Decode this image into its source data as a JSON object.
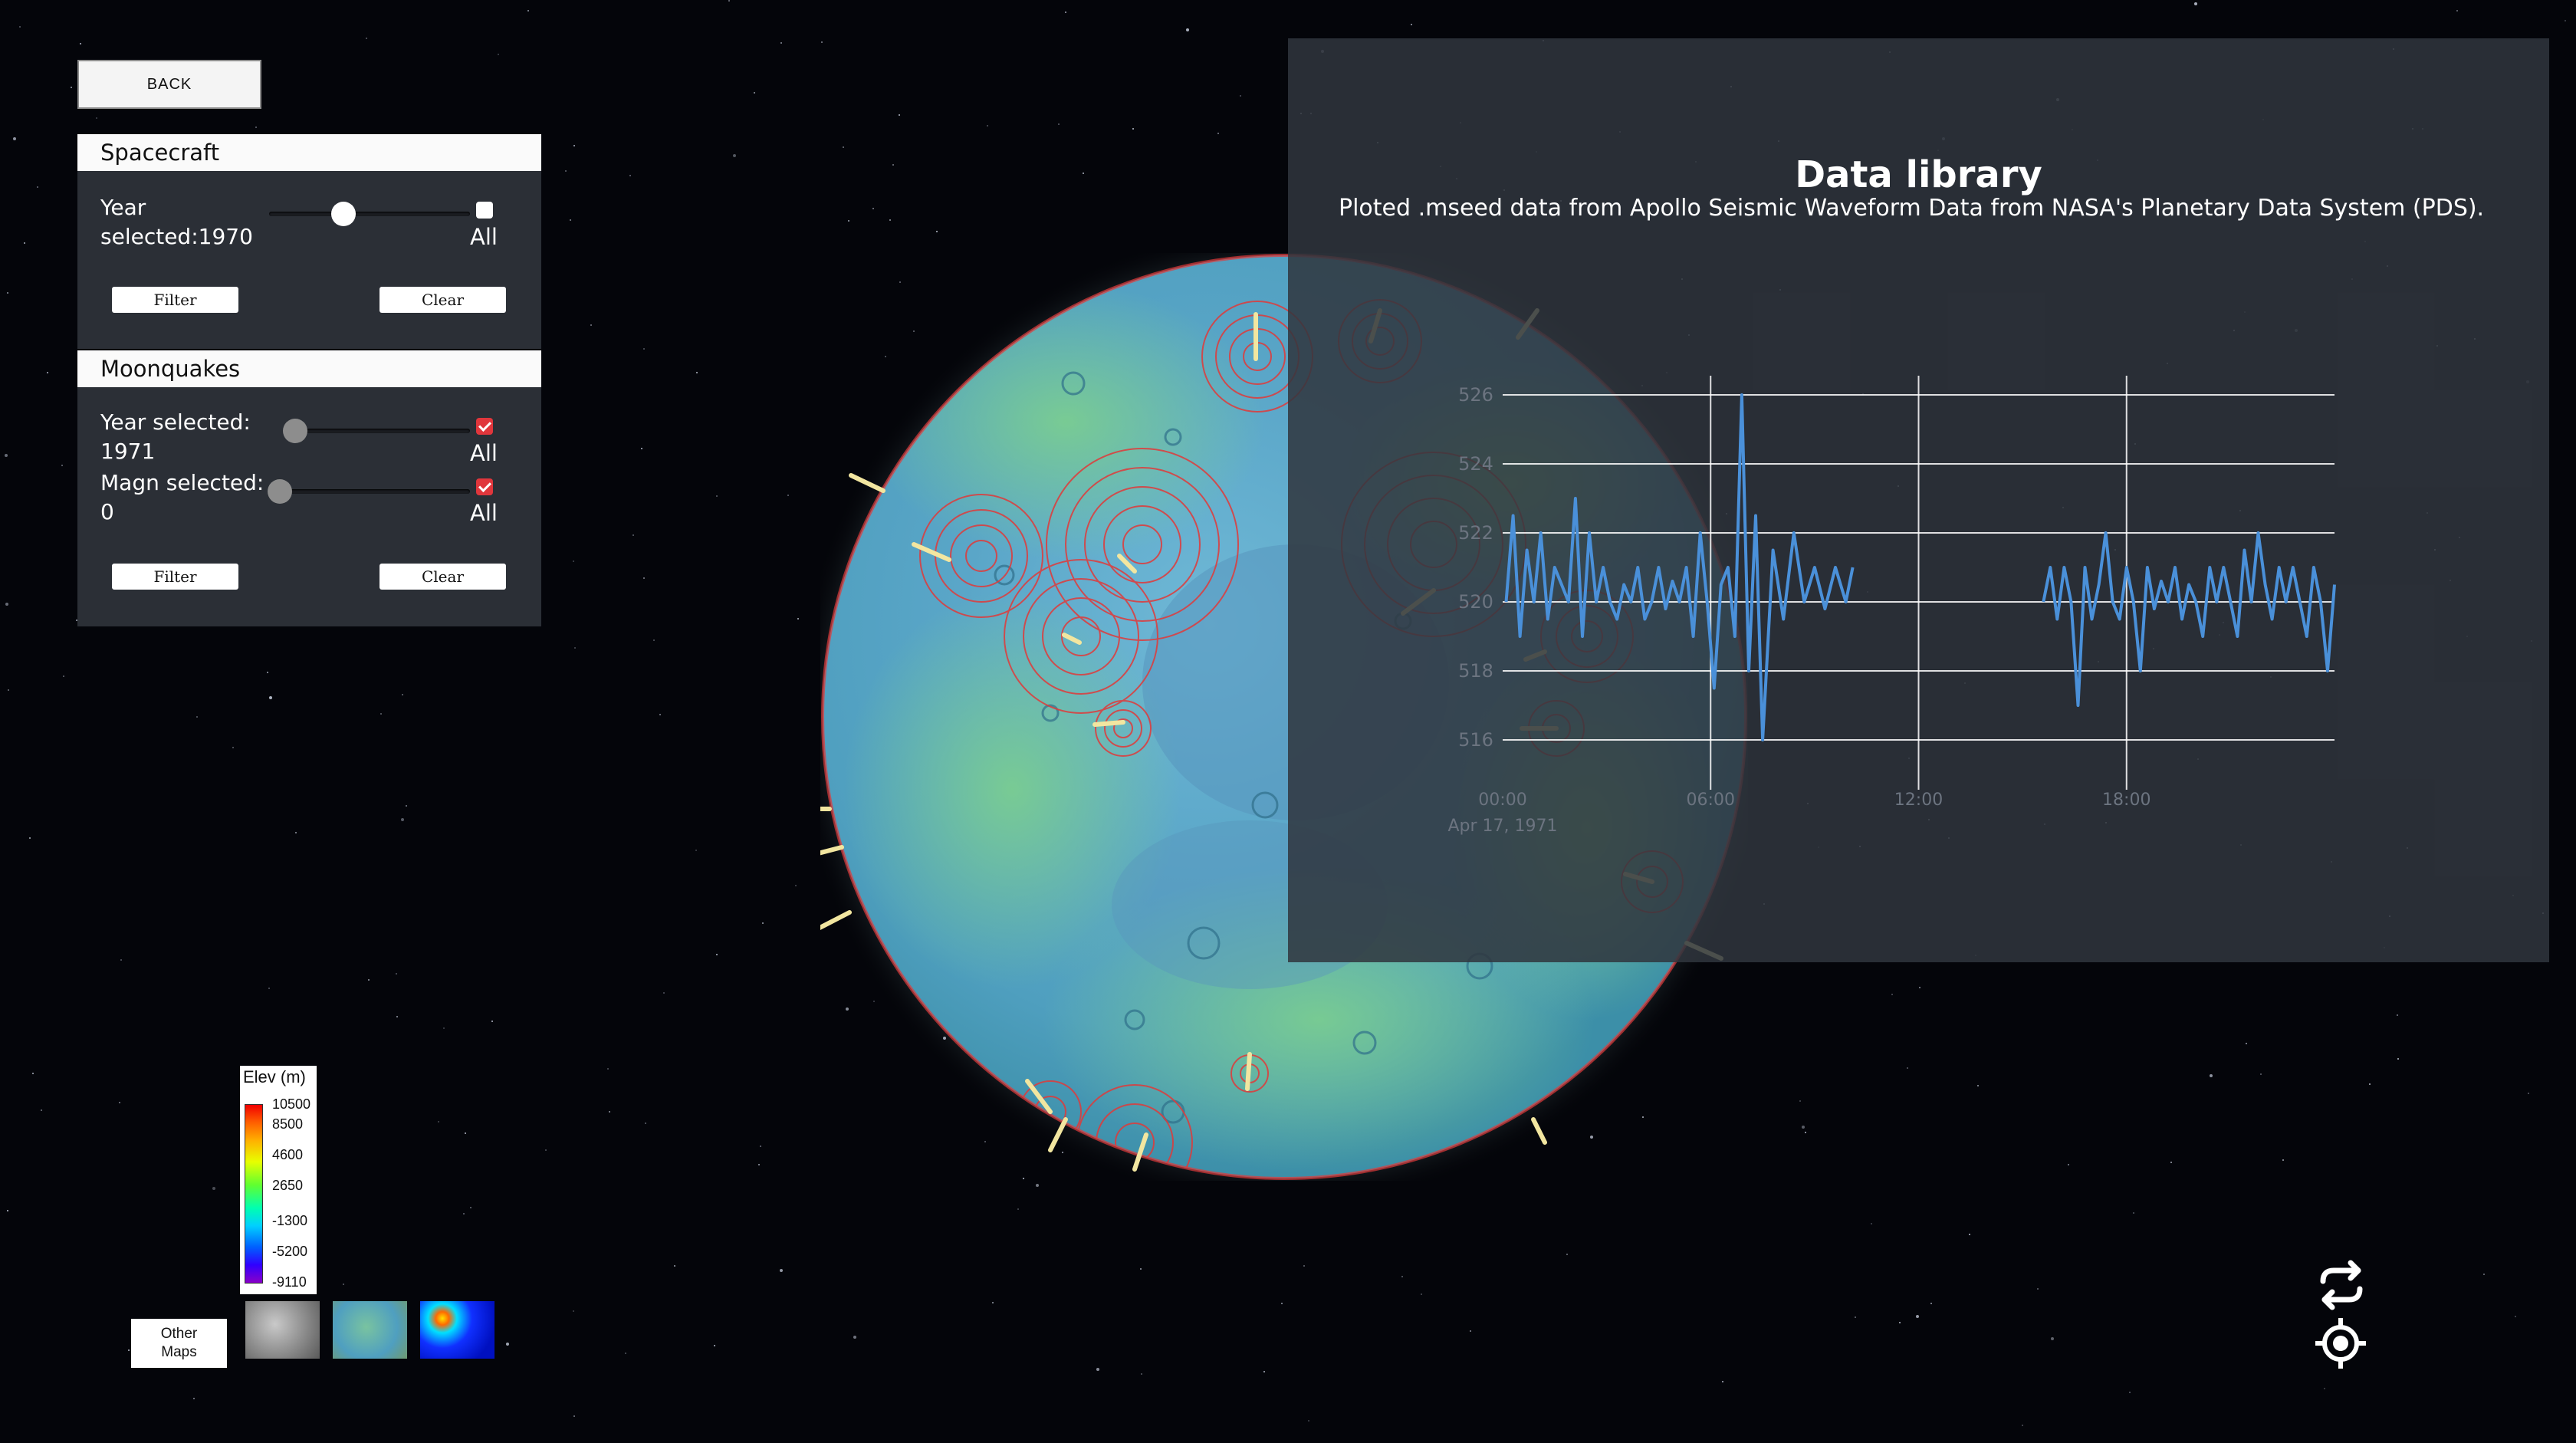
{
  "back_button": "BACK",
  "spacecraft": {
    "title": "Spacecraft",
    "year_label": "Year",
    "year_value": "selected:1970",
    "all_label": "All",
    "all_checked": false,
    "filter_label": "Filter",
    "clear_label": "Clear",
    "year_slider_fraction": 0.35
  },
  "moonquakes": {
    "title": "Moonquakes",
    "year_label": "Year selected:",
    "year_value": "1971",
    "year_all_label": "All",
    "year_all_checked": true,
    "magn_label": "Magn selected:",
    "magn_value": "0",
    "magn_all_label": "All",
    "magn_all_checked": true,
    "filter_label": "Filter",
    "clear_label": "Clear",
    "year_slider_fraction": 0.0,
    "magn_slider_fraction": 0.0
  },
  "data_library": {
    "title": "Data library",
    "subtitle": "Ploted .mseed data from Apollo Seismic Waveform Data from NASA's Planetary Data System (PDS)."
  },
  "chart_data": {
    "type": "line",
    "ylim": [
      515,
      527
    ],
    "y_ticks": [
      "526",
      "524",
      "522",
      "520",
      "518",
      "516"
    ],
    "x_ticks": [
      "00:00",
      "06:00",
      "12:00",
      "18:00"
    ],
    "x_date_label": "Apr 17, 1971",
    "series": [
      {
        "color": "#4a90d9",
        "segments": [
          {
            "hours": [
              0.1,
              0.3,
              0.5,
              0.7,
              0.9,
              1.1,
              1.3,
              1.5,
              1.7,
              1.9,
              2.1,
              2.3,
              2.5,
              2.7,
              2.9,
              3.1,
              3.3,
              3.5,
              3.7,
              3.9,
              4.1,
              4.3,
              4.5,
              4.7,
              4.9,
              5.1,
              5.3,
              5.5,
              5.7,
              5.9,
              6.1,
              6.3,
              6.5,
              6.7,
              6.9,
              7.1,
              7.3,
              7.5,
              7.8,
              8.1,
              8.4,
              8.7,
              9.0,
              9.3,
              9.6,
              9.9,
              10.1
            ],
            "values": [
              520,
              522.5,
              519,
              521.5,
              520,
              522,
              519.5,
              521,
              520.5,
              520,
              523,
              519,
              522,
              520,
              521,
              520,
              519.5,
              520.5,
              520,
              521,
              519.5,
              520,
              521,
              519.8,
              520.6,
              520,
              521,
              519,
              522,
              520,
              517.5,
              520.5,
              521,
              519,
              526,
              518,
              522.5,
              516,
              521.5,
              519.5,
              522,
              520,
              521,
              519.8,
              521,
              520,
              521
            ]
          },
          {
            "hours": [
              15.6,
              15.8,
              16.0,
              16.2,
              16.4,
              16.6,
              16.8,
              17.0,
              17.2,
              17.4,
              17.6,
              17.8,
              18.0,
              18.2,
              18.4,
              18.6,
              18.8,
              19.0,
              19.2,
              19.4,
              19.6,
              19.8,
              20.0,
              20.2,
              20.4,
              20.6,
              20.8,
              21.0,
              21.2,
              21.4,
              21.6,
              21.8,
              22.0,
              22.2,
              22.4,
              22.6,
              22.8,
              23.0,
              23.2,
              23.4,
              23.6,
              23.8,
              24.0
            ],
            "values": [
              520,
              521,
              519.5,
              521,
              520,
              517,
              521,
              519.5,
              520.5,
              522,
              520,
              519.5,
              521,
              520,
              518,
              521,
              519.8,
              520.6,
              520,
              521,
              519.5,
              520.5,
              520,
              519,
              521,
              520,
              521,
              520,
              519,
              521.5,
              520,
              522,
              520.5,
              519.5,
              521,
              520,
              521,
              520,
              519,
              521,
              520,
              518,
              520.5
            ]
          }
        ]
      }
    ]
  },
  "legend": {
    "title": "Elev (m)",
    "ticks": [
      "10500",
      "8500",
      "4600",
      "2650",
      "-1300",
      "-5200",
      "-9110"
    ]
  },
  "other_maps_label_1": "Other",
  "other_maps_label_2": "Maps",
  "colors": {
    "panel_bg": "#2b2f36",
    "contour": "#e03a3a",
    "marker": "#f2e6a0",
    "waveform": "#4a90d9"
  }
}
